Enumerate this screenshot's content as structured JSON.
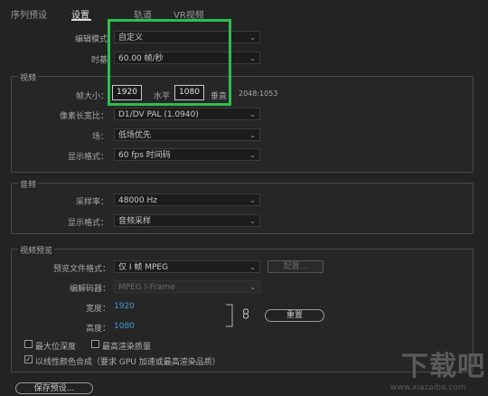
{
  "tabs": [
    {
      "label": "序列预设",
      "active": false
    },
    {
      "label": "设置",
      "active": true
    },
    {
      "label": "轨道",
      "active": false
    },
    {
      "label": "VR视频",
      "active": false
    }
  ],
  "general": {
    "edit_mode_label": "编辑模式：",
    "edit_mode_value": "自定义",
    "timebase_label": "时基：",
    "timebase_value": "60.00  帧/秒"
  },
  "video": {
    "title": "视频",
    "frame_size_label": "帧大小：",
    "width": "1920",
    "horizontal_label": "水平",
    "height": "1080",
    "vertical_label": "垂直",
    "ratio": "2048:1053",
    "pixel_aspect_label": "像素长宽比：",
    "pixel_aspect_value": "D1/DV PAL (1.0940)",
    "field_label": "场：",
    "field_value": "低场优先",
    "display_format_label": "显示格式：",
    "display_format_value": "60 fps 时间码"
  },
  "audio": {
    "title": "音频",
    "sample_rate_label": "采样率：",
    "sample_rate_value": "48000 Hz",
    "display_format_label": "显示格式：",
    "display_format_value": "音频采样"
  },
  "preview": {
    "title": "视频预览",
    "file_format_label": "预览文件格式：",
    "file_format_value": "仅 I 帧 MPEG",
    "configure_label": "配置...",
    "codec_label": "编解码器：",
    "codec_value": "MPEG I-Frame",
    "width_label": "宽度：",
    "width_value": "1920",
    "height_label": "高度：",
    "height_value": "1080",
    "reset_label": "重置",
    "max_bit_depth": "最大位深度",
    "max_render_quality": "最高渲染质量",
    "linear_color": "以线性颜色合成（要求 GPU 加速或最高渲染品质）"
  },
  "footer": {
    "save_preset": "保存预设..."
  },
  "watermark": {
    "logo": "下载吧",
    "url": "www.xiazaiba.com"
  },
  "colors": {
    "highlight": "#2dbe4c",
    "link_blue": "#3f9bd6"
  }
}
